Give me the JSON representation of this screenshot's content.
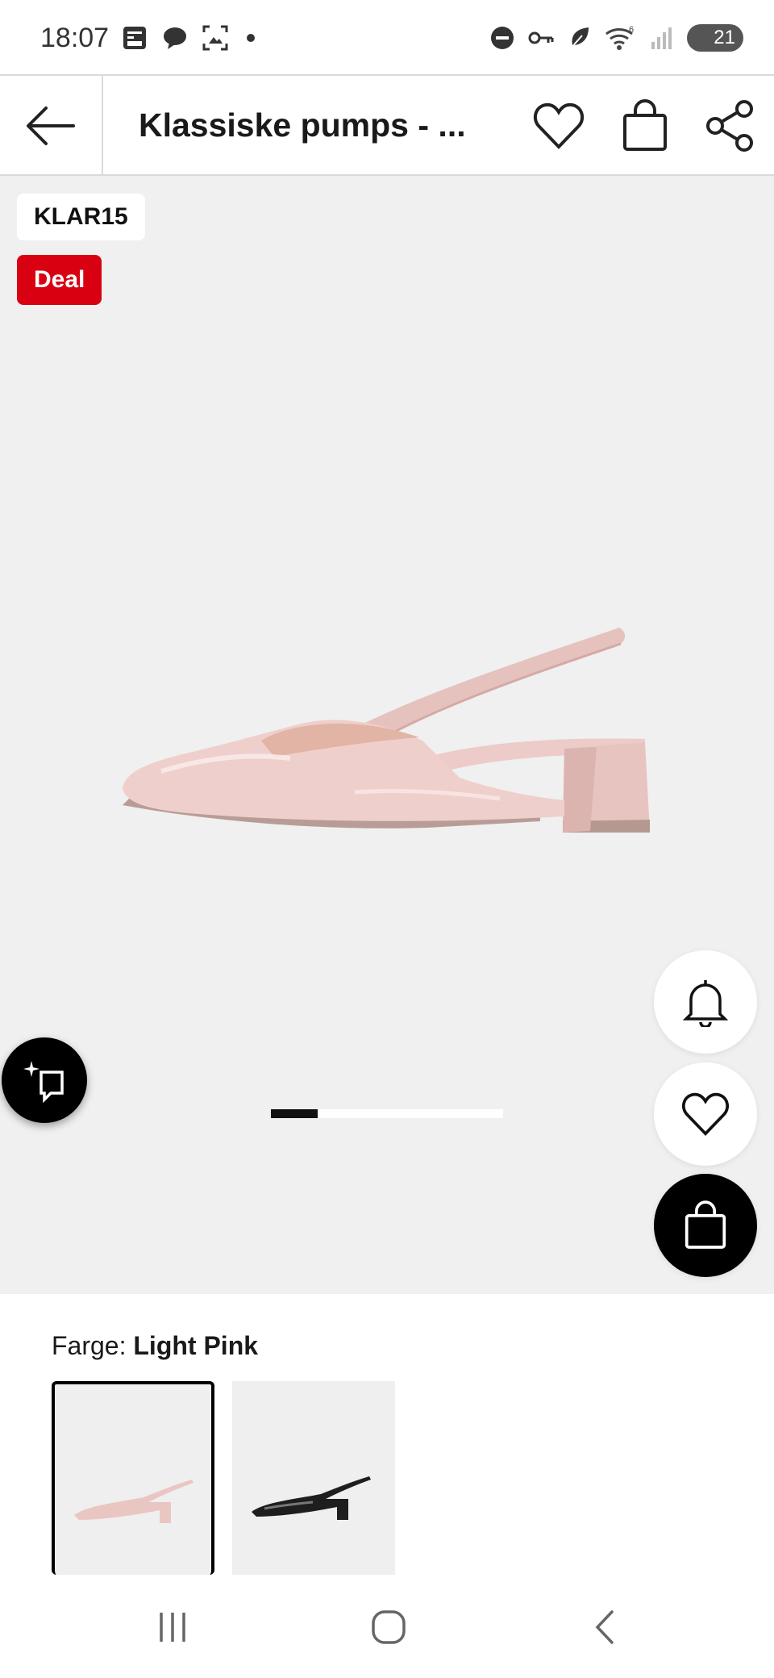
{
  "status_bar": {
    "time": "18:07",
    "battery_level": "21",
    "left_icons": [
      "news-icon",
      "chat-bubble-icon",
      "screenshot-icon",
      "dot-icon"
    ],
    "right_icons": [
      "do-not-disturb-icon",
      "key-icon",
      "leaf-icon",
      "wifi-icon",
      "signal-icon"
    ]
  },
  "app_bar": {
    "title": "Klassiske pumps - ...",
    "icons": [
      "back-arrow-icon",
      "heart-icon",
      "shopping-bag-icon",
      "share-icon"
    ]
  },
  "gallery": {
    "code_badge": "KLAR15",
    "deal_badge": "Deal",
    "image_index": 1,
    "image_count": 5,
    "product_color_hex": "#e9c9c7",
    "deal_color": "#d90012"
  },
  "color_selector": {
    "label": "Farge:",
    "selected_value": "Light Pink",
    "options": [
      {
        "name": "Light Pink",
        "selected": true
      },
      {
        "name": "Black",
        "selected": false
      }
    ]
  },
  "floating_actions": [
    "bell-icon",
    "heart-icon",
    "shopping-bag-icon",
    "ai-assistant-icon"
  ],
  "nav_bar": [
    "recent-apps-icon",
    "home-icon",
    "back-icon"
  ]
}
